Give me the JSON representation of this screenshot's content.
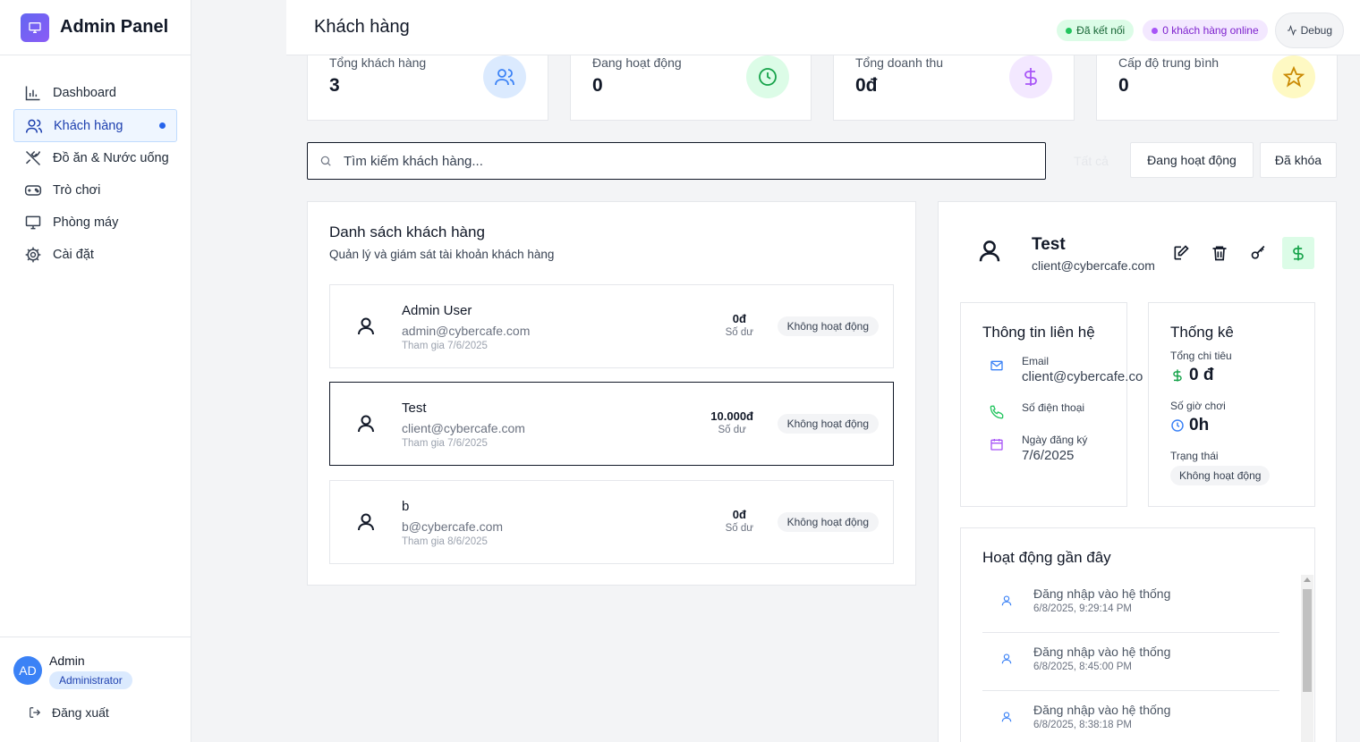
{
  "sidebar": {
    "brand": "Admin Panel",
    "items": [
      {
        "label": "Dashboard",
        "icon": "bar-chart-icon"
      },
      {
        "label": "Khách hàng",
        "icon": "users-icon",
        "active": true
      },
      {
        "label": "Đồ ăn & Nước uống",
        "icon": "utensils-icon"
      },
      {
        "label": "Trò chơi",
        "icon": "gamepad-icon"
      },
      {
        "label": "Phòng máy",
        "icon": "monitor-icon"
      },
      {
        "label": "Cài đặt",
        "icon": "gear-icon"
      }
    ],
    "user": {
      "initials": "AD",
      "name": "Admin",
      "role": "Administrator"
    },
    "logout": "Đăng xuất"
  },
  "header": {
    "title": "Khách hàng",
    "connected": "Đã kết nối",
    "online": "0 khách hàng online",
    "debug": "Debug"
  },
  "stats": [
    {
      "label": "Tổng khách hàng",
      "value": "3",
      "icon": "users-icon",
      "color": "#3b82f6"
    },
    {
      "label": "Đang hoạt động",
      "value": "0",
      "icon": "clock-icon",
      "color": "#22c55e"
    },
    {
      "label": "Tổng doanh thu",
      "value": "0đ",
      "icon": "dollar-icon",
      "color": "#a855f7"
    },
    {
      "label": "Cấp độ trung bình",
      "value": "0",
      "icon": "star-icon",
      "color": "#eab308"
    }
  ],
  "search": {
    "placeholder": "Tìm kiếm khách hàng..."
  },
  "filters": {
    "all": "Tất cả",
    "active": "Đang hoạt động",
    "locked": "Đã khóa"
  },
  "list": {
    "title": "Danh sách khách hàng",
    "subtitle": "Quản lý và giám sát tài khoản khách hàng",
    "balance_label": "Số dư",
    "customers": [
      {
        "name": "Admin User",
        "email": "admin@cybercafe.com",
        "joined": "Tham gia 7/6/2025",
        "balance": "0đ",
        "status": "Không hoạt động"
      },
      {
        "name": "Test",
        "email": "client@cybercafe.com",
        "joined": "Tham gia 7/6/2025",
        "balance": "10.000đ",
        "status": "Không hoạt động",
        "selected": true
      },
      {
        "name": "b",
        "email": "b@cybercafe.com",
        "joined": "Tham gia 8/6/2025",
        "balance": "0đ",
        "status": "Không hoạt động"
      }
    ]
  },
  "detail": {
    "name": "Test",
    "email": "client@cybercafe.com",
    "contact": {
      "title": "Thông tin liên hệ",
      "email_label": "Email",
      "email_value": "client@cybercafe.co",
      "phone_label": "Số điện thoại",
      "reg_label": "Ngày đăng ký",
      "reg_value": "7/6/2025"
    },
    "stats": {
      "title": "Thống kê",
      "spend_label": "Tổng chi tiêu",
      "spend_value": "0 đ",
      "hours_label": "Số giờ chơi",
      "hours_value": "0h",
      "status_label": "Trạng thái",
      "status_value": "Không hoạt động"
    },
    "activity": {
      "title": "Hoạt động gần đây",
      "items": [
        {
          "title": "Đăng nhập vào hệ thống",
          "time": "6/8/2025, 9:29:14 PM"
        },
        {
          "title": "Đăng nhập vào hệ thống",
          "time": "6/8/2025, 8:45:00 PM"
        },
        {
          "title": "Đăng nhập vào hệ thống",
          "time": "6/8/2025, 8:38:18 PM"
        }
      ]
    }
  }
}
